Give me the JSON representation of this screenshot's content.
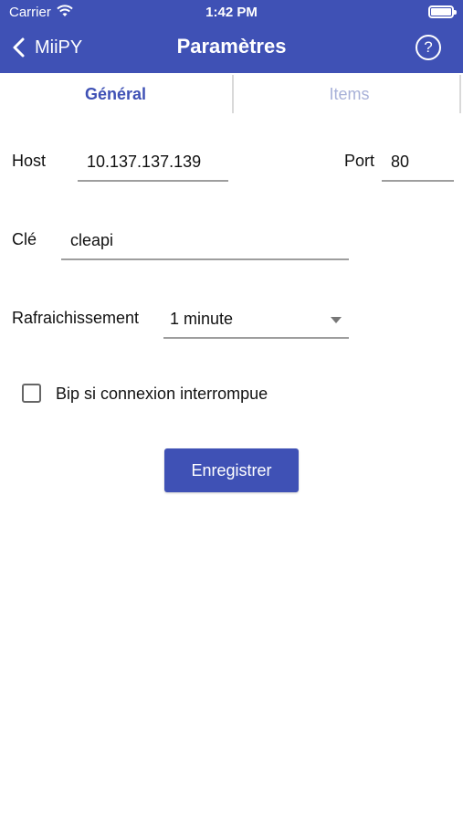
{
  "status_bar": {
    "carrier": "Carrier",
    "time": "1:42 PM"
  },
  "nav": {
    "back_label": "MiiPY",
    "title": "Paramètres",
    "help_symbol": "?"
  },
  "tabs": [
    {
      "label": "Général",
      "active": true
    },
    {
      "label": "Items",
      "active": false
    }
  ],
  "form": {
    "host_label": "Host",
    "host_value": "10.137.137.139",
    "port_label": "Port",
    "port_value": "80",
    "key_label": "Clé",
    "key_value": "cleapi",
    "refresh_label": "Rafraichissement",
    "refresh_value": "1 minute",
    "beep_label": "Bip si connexion interrompue",
    "beep_checked": false,
    "save_label": "Enregistrer"
  },
  "colors": {
    "primary": "#3f51b5",
    "tab_inactive": "#a8b1d8"
  },
  "icons": [
    "wifi-icon",
    "battery-icon",
    "chevron-left-icon",
    "help-icon",
    "dropdown-arrow-icon",
    "checkbox-icon"
  ]
}
